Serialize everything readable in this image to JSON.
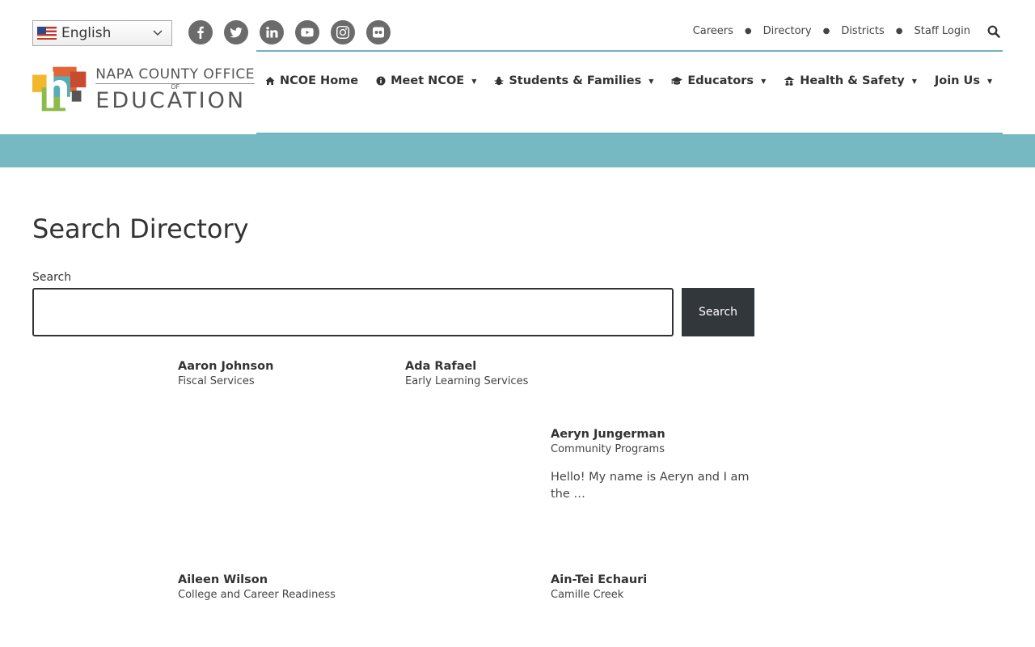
{
  "language": {
    "selected": "English"
  },
  "social_icons": [
    "facebook-icon",
    "twitter-icon",
    "linkedin-icon",
    "youtube-icon",
    "instagram-icon",
    "flickr-icon"
  ],
  "top_links": [
    "Careers",
    "Directory",
    "Districts",
    "Staff Login"
  ],
  "logo": {
    "line1": "NAPA COUNTY OFFICE",
    "of": "OF",
    "line2": "EDUCATION"
  },
  "nav": [
    {
      "label": "NCOE Home",
      "icon": "home-icon"
    },
    {
      "label": "Meet NCOE",
      "icon": "info-icon"
    },
    {
      "label": "Students & Families",
      "icon": "bug-icon"
    },
    {
      "label": "Educators",
      "icon": "graduation-cap-icon"
    },
    {
      "label": "Health & Safety",
      "icon": "people-roof-icon"
    },
    {
      "label": "Join Us"
    }
  ],
  "colors": {
    "accent_teal": "#76b9c3",
    "line_teal": "#6fb3bf",
    "button_dark": "#32373c",
    "social_gray": "#6b6b6b"
  },
  "page": {
    "title": "Search Directory"
  },
  "search": {
    "label": "Search",
    "value": "",
    "placeholder": "",
    "button": "Search"
  },
  "people": [
    {
      "name": "Aaron Johnson",
      "dept": "Fiscal Services"
    },
    {
      "name": "Ada Rafael",
      "dept": "Early Learning Services"
    },
    {
      "name": "Aeryn Jungerman",
      "dept": "Community Programs",
      "bio": "Hello! My name is Aeryn and I am the …"
    },
    {
      "name": "Aileen Wilson",
      "dept": "College and Career Readiness"
    },
    {
      "name": "Ain-Tei Echauri",
      "dept": "Camille Creek"
    }
  ]
}
